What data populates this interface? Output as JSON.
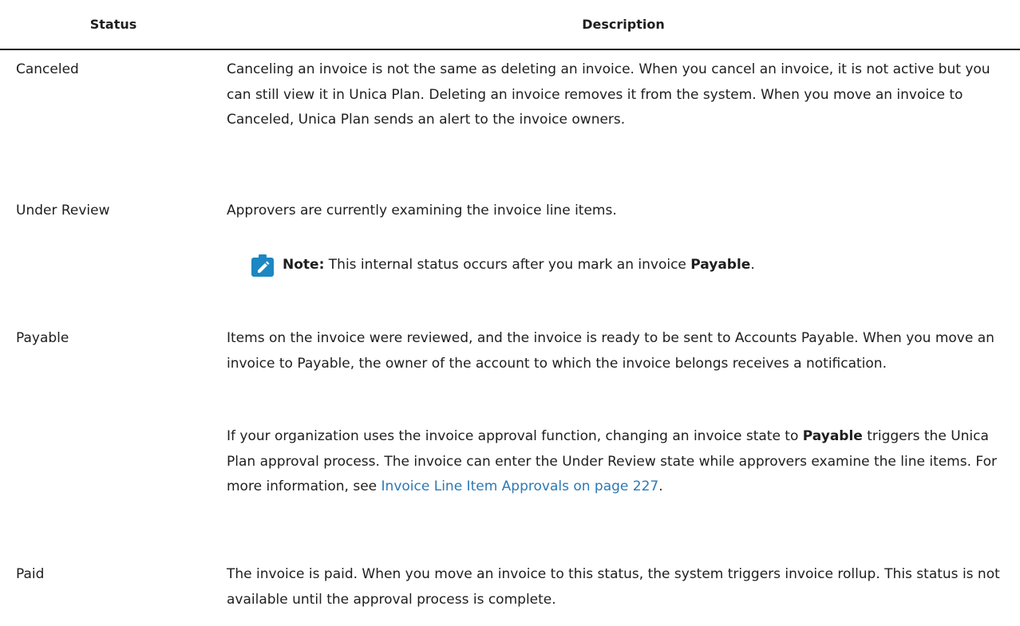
{
  "table": {
    "headers": {
      "status": "Status",
      "description": "Description"
    },
    "rows": [
      {
        "status": "Canceled",
        "paragraphs": [
          "Canceling an invoice is not the same as deleting an invoice. When you cancel an invoice, it is not active but you can still view it in Unica Plan. Deleting an invoice removes it from the system. When you move an invoice to Canceled, Unica Plan sends an alert to the invoice owners."
        ]
      },
      {
        "status": "Under Review",
        "paragraphs": [
          "Approvers are currently examining the invoice line items."
        ],
        "note": {
          "label": "Note:",
          "text": "This internal status occurs after you mark an invoice",
          "emphasis": "Payable",
          "end": "."
        }
      },
      {
        "status": "Payable",
        "paragraphs": [
          "Items on the invoice were reviewed, and the invoice is ready to be sent to Accounts Payable. When you move an invoice to Payable, the owner of the account to which the invoice belongs receives a notification."
        ],
        "para2": {
          "before": "If your organization uses the invoice approval function, changing an invoice state to",
          "emphasis": "Payable",
          "middle": "triggers the Unica Plan approval process. The invoice can enter the Under Review state while approvers examine the line items. For more information, see",
          "link": "Invoice Line Item Approvals on page 227",
          "end": "."
        }
      },
      {
        "status": "Paid",
        "paragraphs": [
          "The invoice is paid. When you move an invoice to this status, the system triggers invoice rollup. This status is not available until the approval process is complete."
        ]
      }
    ]
  },
  "colors": {
    "note_icon": "#1b87c3",
    "link": "#2d79b5",
    "rule": "#1a1a1a"
  },
  "icons": {
    "note": "pencil-note-icon"
  }
}
